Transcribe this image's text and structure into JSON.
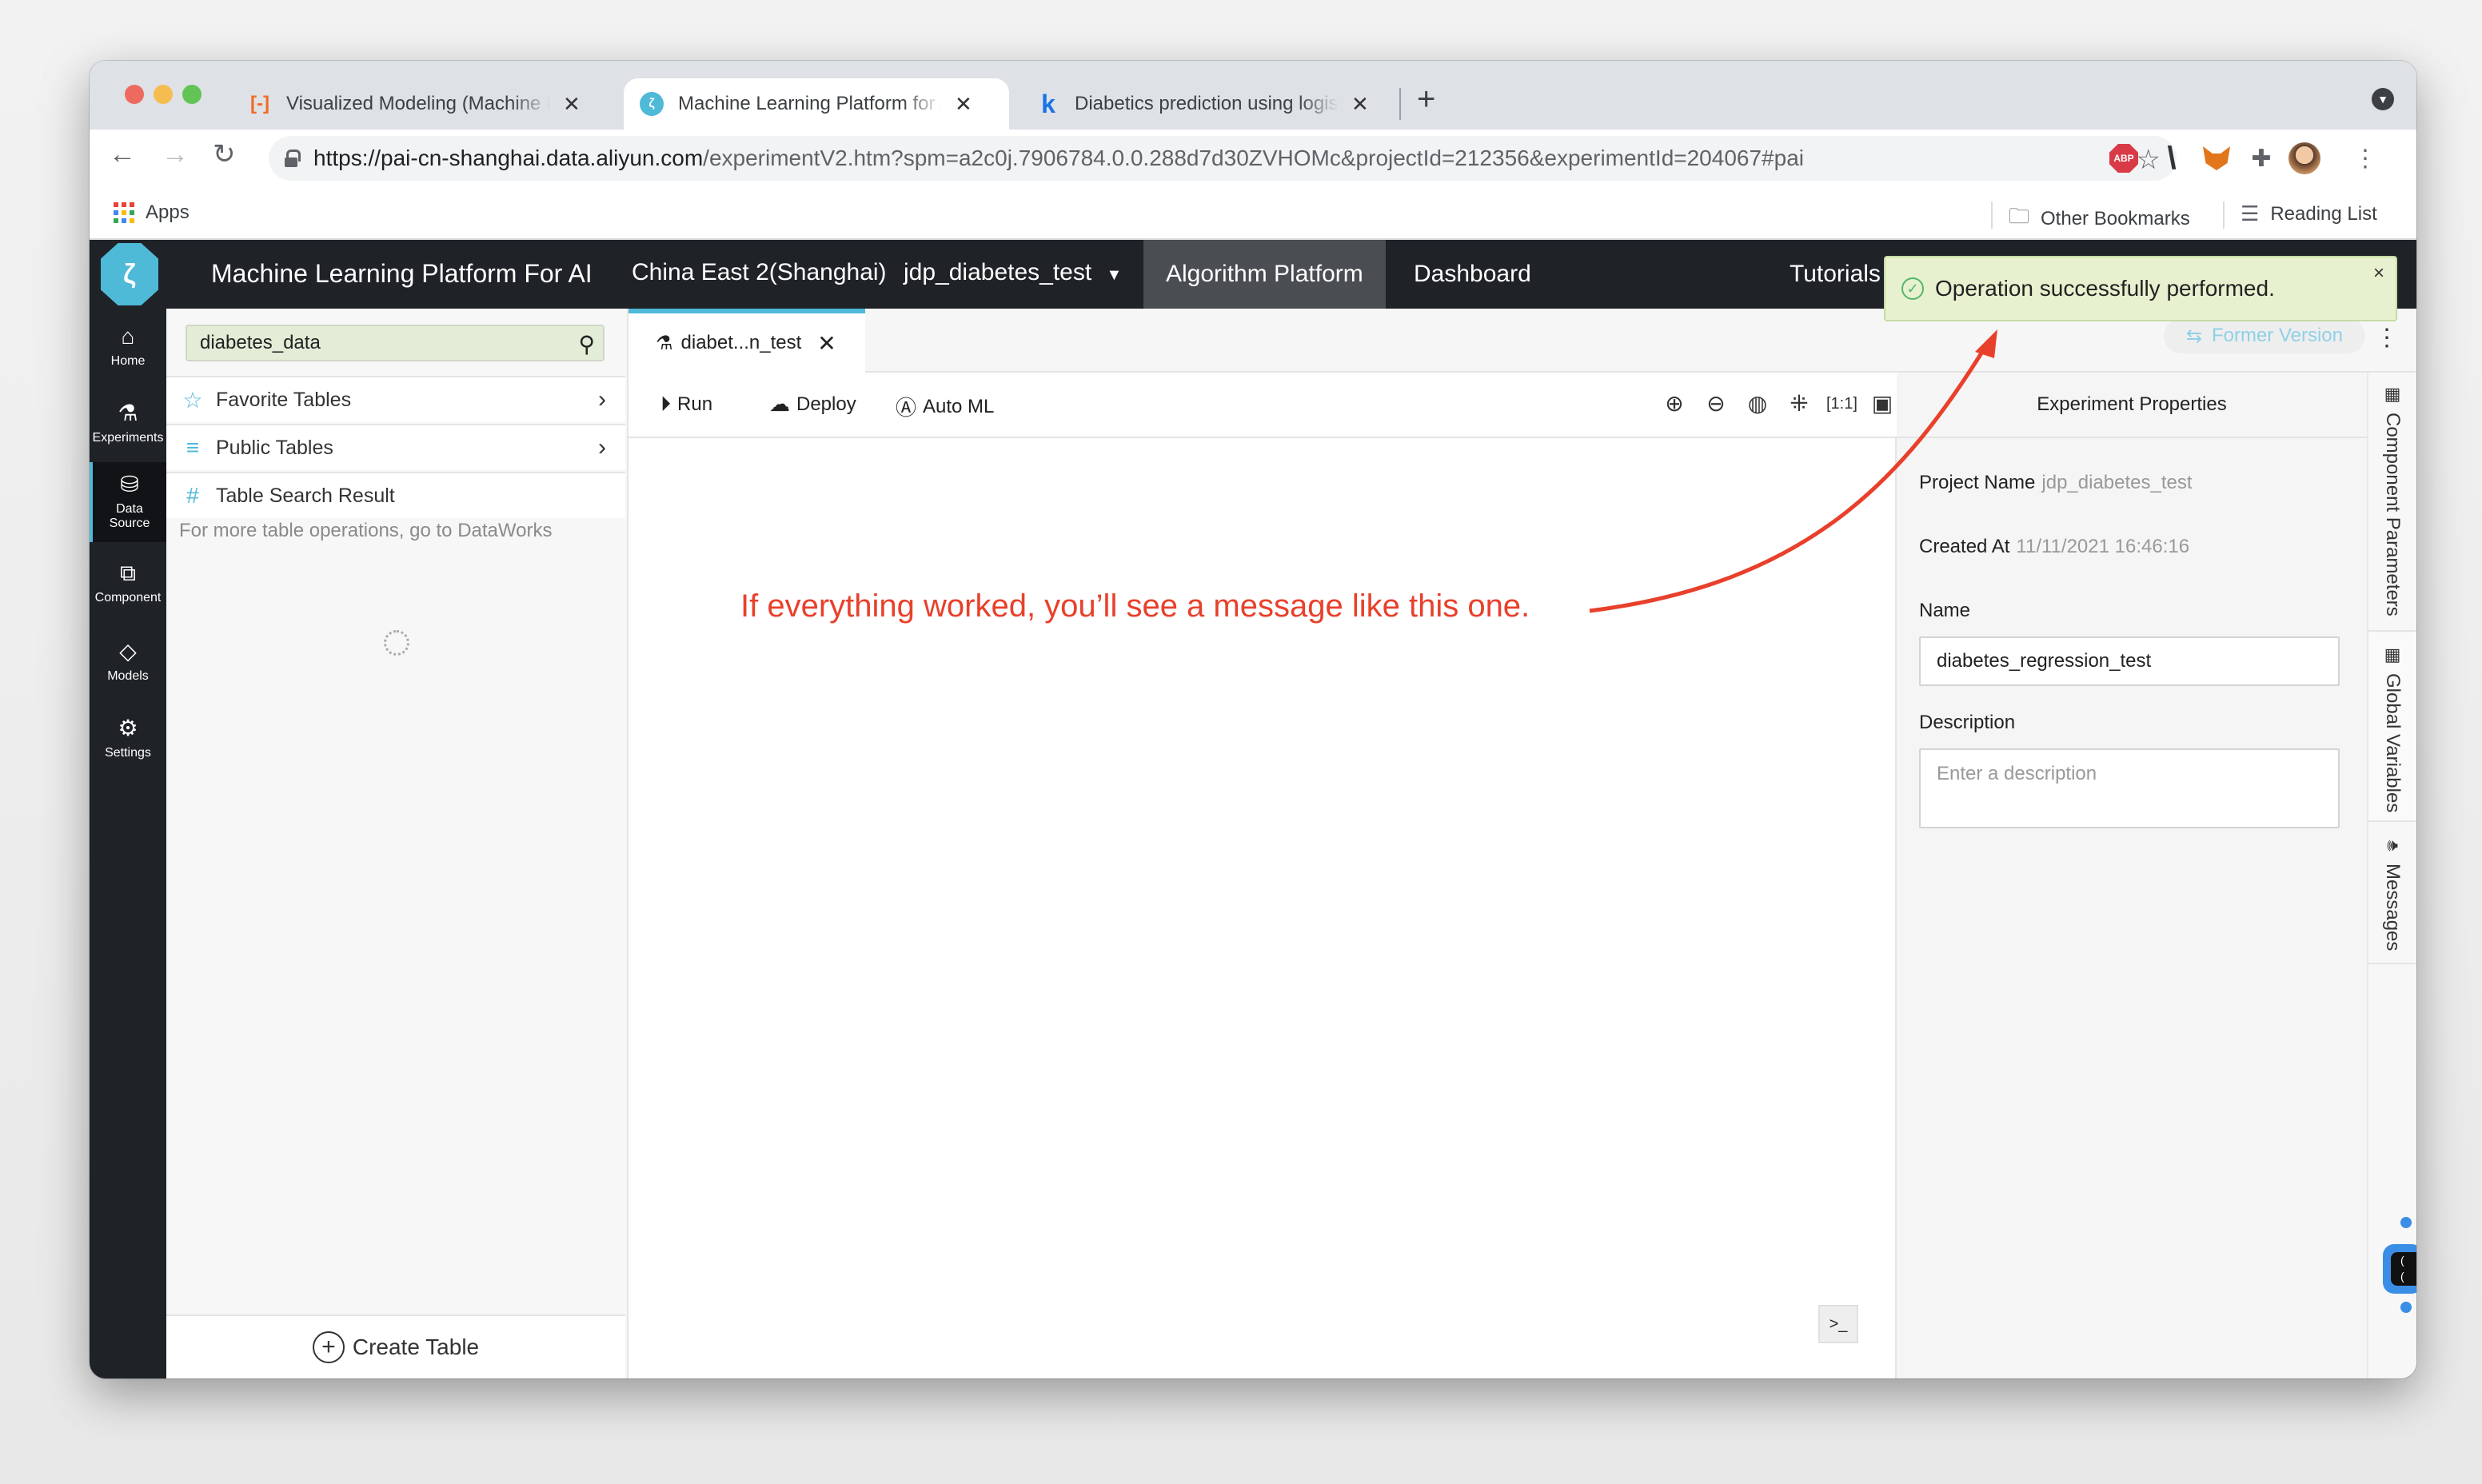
{
  "browser": {
    "tabs": [
      {
        "title": "Visualized Modeling (Machine Learning",
        "favicon": "alibaba-cloud-icon",
        "favicon_color": "#f26a22"
      },
      {
        "title": "Machine Learning Platform for AI",
        "favicon": "pai-logo-icon",
        "favicon_color": "#4fb9d8",
        "active": true
      },
      {
        "title": "Diabetics prediction using logistic",
        "favicon": "k-icon",
        "favicon_color": "#1a73e8"
      }
    ],
    "new_tab": "+",
    "url_host": "https://pai-cn-shanghai.data.aliyun.com",
    "url_path": "/experimentV2.htm?spm=a2c0j.7906784.0.0.288d7d30ZVHOMc&projectId=212356&experimentId=204067#pai",
    "extensions": [
      "ABP",
      "\\",
      "metamask-fox-icon",
      "puzzle-icon",
      "profile-avatar"
    ],
    "bookmarks": {
      "apps": "Apps",
      "other": "Other Bookmarks",
      "reading_list": "Reading List"
    }
  },
  "header": {
    "product": "Machine Learning Platform For AI",
    "region": "China East 2(Shanghai)",
    "project": "jdp_diabetes_test",
    "nav": [
      {
        "label": "Algorithm Platform",
        "active": true
      },
      {
        "label": "Dashboard"
      },
      {
        "label": "Tutorials"
      }
    ]
  },
  "rail": [
    {
      "label": "Home",
      "icon": "home-icon"
    },
    {
      "label": "Experiments",
      "icon": "flask-icon"
    },
    {
      "label": "Data Source",
      "icon": "database-icon",
      "active": true
    },
    {
      "label": "Component",
      "icon": "puzzle-icon"
    },
    {
      "label": "Models",
      "icon": "diamond-icon"
    },
    {
      "label": "Settings",
      "icon": "gear-icon"
    }
  ],
  "datasource": {
    "search_value": "diabetes_data",
    "rows": [
      {
        "label": "Favorite Tables",
        "icon": "star-icon"
      },
      {
        "label": "Public Tables",
        "icon": "list-icon"
      },
      {
        "label": "Table Search Result",
        "icon": "hash-icon"
      }
    ],
    "note": "For more table operations, go to DataWorks",
    "create_table": "Create Table"
  },
  "editor": {
    "tab_label": "diabet...n_test",
    "former_version": "Former Version",
    "toolbar": {
      "run": "Run",
      "deploy": "Deploy",
      "automl": "Auto ML"
    },
    "tools": [
      "zoom-in-icon",
      "zoom-out-icon",
      "globe-icon",
      "fit-center-icon",
      "actual-size-icon",
      "layout-icon",
      "fullscreen-icon"
    ]
  },
  "annotation": "If everything worked, you’ll see a message like this one.",
  "annotation_color": "#e8402b",
  "properties": {
    "title": "Experiment Properties",
    "project_name_label": "Project Name",
    "project_name": "jdp_diabetes_test",
    "created_at_label": "Created At",
    "created_at": "11/11/2021 16:46:16",
    "name_label": "Name",
    "name_value": "diabetes_regression_test",
    "description_label": "Description",
    "description_placeholder": "Enter a description"
  },
  "side_tabs": [
    "Component Parameters",
    "Global Variables",
    "Messages"
  ],
  "toast": {
    "message": "Operation successfully performed.",
    "close": "×",
    "status_color": "#52b66b"
  }
}
